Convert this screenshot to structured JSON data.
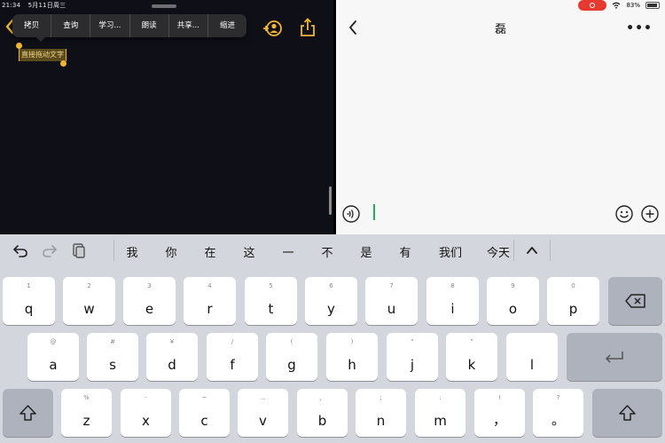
{
  "status_left": {
    "time": "21:34",
    "date": "5月11日周三"
  },
  "status_right": {
    "wifi": "wifi-icon",
    "battery_percent": "83%"
  },
  "context_menu": {
    "items": [
      "拷贝",
      "查询",
      "学习...",
      "朗读",
      "共享...",
      "缩进"
    ]
  },
  "note": {
    "selected_text": "直接拖动文字"
  },
  "chat": {
    "title": "磊",
    "more": "•••",
    "input_value": ""
  },
  "keyboard": {
    "candidates": [
      "我",
      "你",
      "在",
      "这",
      "一",
      "不",
      "是",
      "有",
      "我们",
      "今天"
    ],
    "row1": [
      {
        "hint": "1",
        "key": "q"
      },
      {
        "hint": "2",
        "key": "w"
      },
      {
        "hint": "3",
        "key": "e"
      },
      {
        "hint": "4",
        "key": "r"
      },
      {
        "hint": "5",
        "key": "t"
      },
      {
        "hint": "6",
        "key": "y"
      },
      {
        "hint": "7",
        "key": "u"
      },
      {
        "hint": "8",
        "key": "i"
      },
      {
        "hint": "9",
        "key": "o"
      },
      {
        "hint": "0",
        "key": "p"
      }
    ],
    "row2": [
      {
        "hint": "@",
        "key": "a"
      },
      {
        "hint": "#",
        "key": "s"
      },
      {
        "hint": "¥",
        "key": "d"
      },
      {
        "hint": "/",
        "key": "f"
      },
      {
        "hint": "(",
        "key": "g"
      },
      {
        "hint": ")",
        "key": "h"
      },
      {
        "hint": "“",
        "key": "j"
      },
      {
        "hint": "”",
        "key": "k"
      },
      {
        "hint": "",
        "key": "l"
      }
    ],
    "row3": [
      {
        "hint": "%",
        "key": "z"
      },
      {
        "hint": "-",
        "key": "x"
      },
      {
        "hint": "~",
        "key": "c"
      },
      {
        "hint": "...",
        "key": "v"
      },
      {
        "hint": "、",
        "key": "b"
      },
      {
        "hint": ";",
        "key": "n"
      },
      {
        "hint": ":",
        "key": "m"
      },
      {
        "hint": "!",
        "key": "，"
      },
      {
        "hint": "?",
        "key": "。"
      }
    ]
  },
  "colors": {
    "accent_yellow": "#f0b630",
    "cursor_green": "#1fae5b",
    "record_red": "#e63a30"
  }
}
